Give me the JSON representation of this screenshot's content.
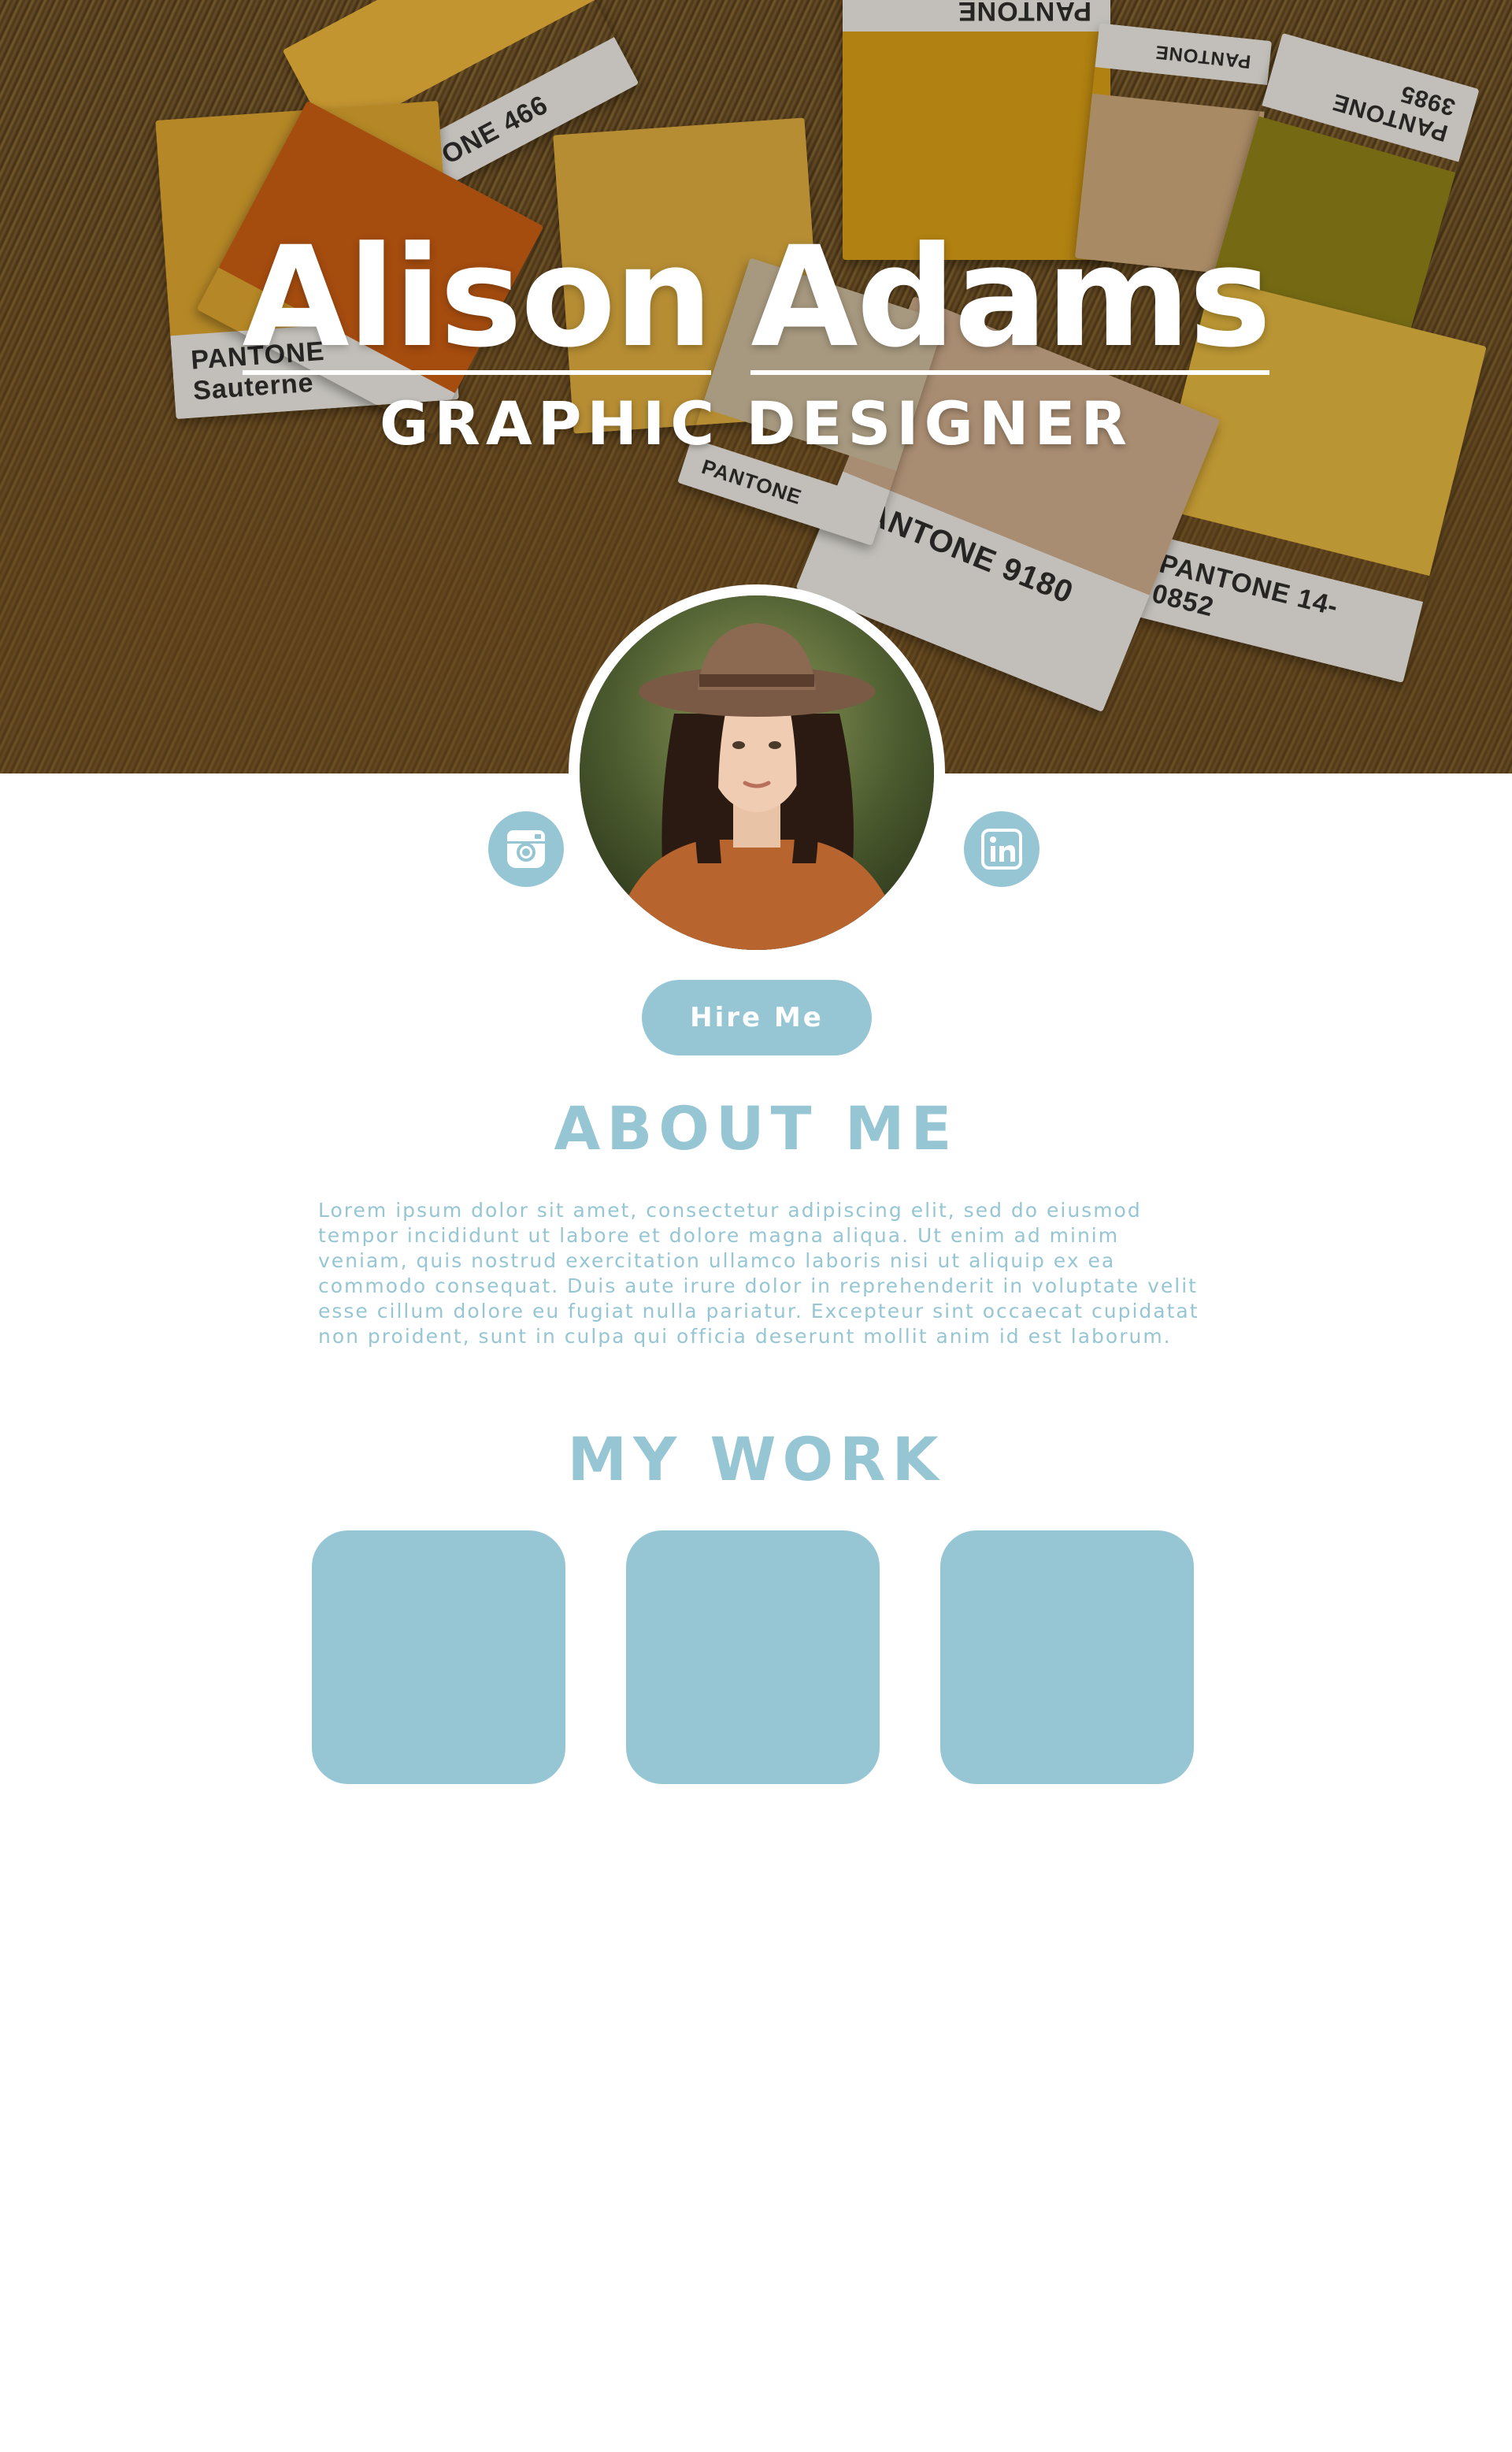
{
  "hero": {
    "name_first": "Alison",
    "name_last": "Adams",
    "role": "GRAPHIC DESIGNER",
    "swatches": [
      {
        "label": "PANTONE 466"
      },
      {
        "label": "PANTONE"
      },
      {
        "label": "PANTONE"
      },
      {
        "label": "PANTONE 3985"
      },
      {
        "label": "PANTONE 9180"
      },
      {
        "label": "PANTONE 14-0852"
      },
      {
        "label": "PANTONE Sauterne"
      },
      {
        "label": "PANTONE"
      }
    ]
  },
  "profile": {
    "avatar_alt": "avatar",
    "social": {
      "instagram_icon": "instagram-icon",
      "linkedin_icon": "linkedin-icon"
    }
  },
  "cta": {
    "hire_label": "Hire Me"
  },
  "about": {
    "heading": "ABOUT ME",
    "body": "Lorem ipsum dolor sit amet, consectetur adipiscing elit, sed do eiusmod tempor incididunt ut labore et dolore magna aliqua. Ut enim ad minim veniam, quis nostrud exercitation ullamco laboris nisi ut aliquip ex ea commodo consequat. Duis aute irure dolor in reprehenderit in voluptate velit esse cillum dolore eu fugiat nulla pariatur. Excepteur sint occaecat cupidatat non proident, sunt in culpa qui officia deserunt mollit anim id est laborum."
  },
  "work": {
    "heading": "MY WORK",
    "tile_count": 3
  },
  "colors": {
    "accent": "#96c6d3",
    "background": "#ffffff",
    "hero_text": "#ffffff"
  }
}
